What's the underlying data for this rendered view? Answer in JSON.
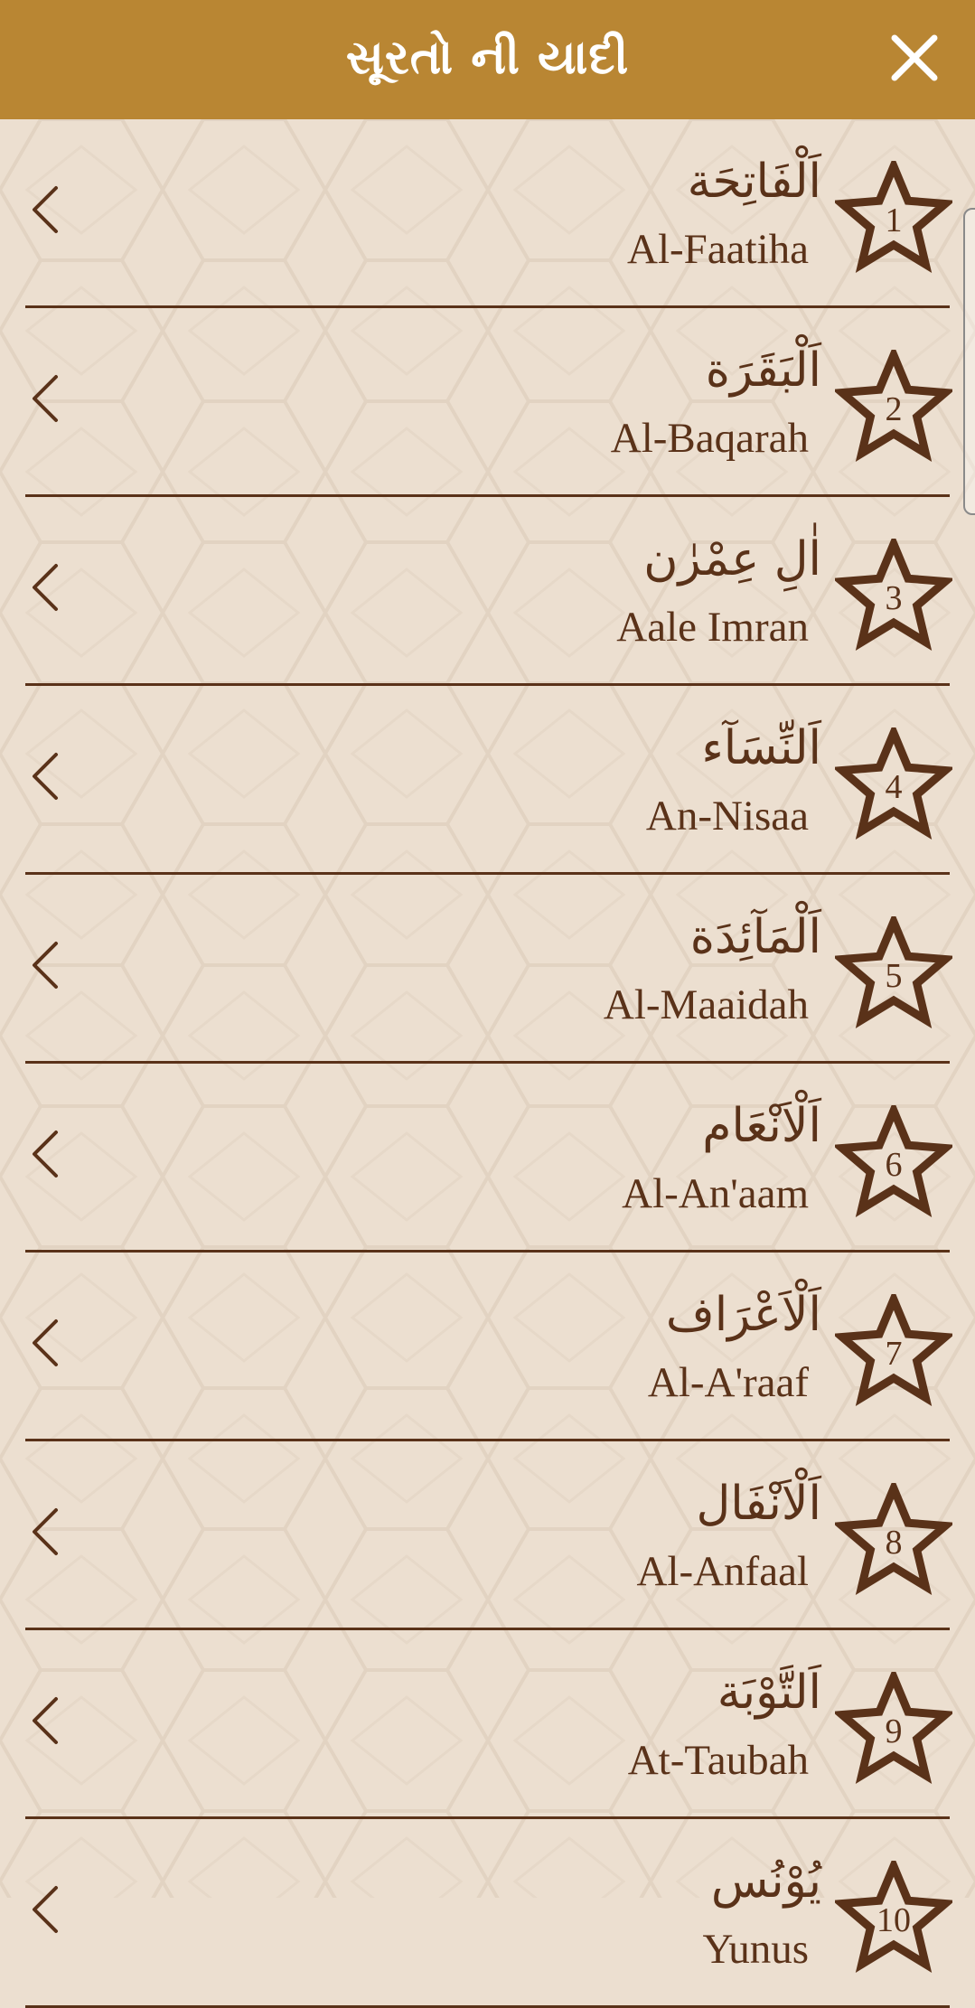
{
  "header": {
    "title": "સૂરતો ની યાદી",
    "close_icon": "close-icon"
  },
  "colors": {
    "header_bg": "#b98633",
    "page_bg": "#ecdfd0",
    "text": "#5a3219"
  },
  "surahs": [
    {
      "number": "1",
      "arabic": "اَلْفَاتِحَة",
      "name": "Al-Faatiha"
    },
    {
      "number": "2",
      "arabic": "اَلْبَقَرَة",
      "name": "Al-Baqarah"
    },
    {
      "number": "3",
      "arabic": "اٰلِ عِمْرٰن",
      "name": "Aale Imran"
    },
    {
      "number": "4",
      "arabic": "اَلنِّسَآء",
      "name": "An-Nisaa"
    },
    {
      "number": "5",
      "arabic": "اَلْمَآئِدَة",
      "name": "Al-Maaidah"
    },
    {
      "number": "6",
      "arabic": "اَلْاَنْعَام",
      "name": "Al-An'aam"
    },
    {
      "number": "7",
      "arabic": "اَلْاَعْرَاف",
      "name": "Al-A'raaf"
    },
    {
      "number": "8",
      "arabic": "اَلْاَنْفَال",
      "name": "Al-Anfaal"
    },
    {
      "number": "9",
      "arabic": "اَلتَّوْبَة",
      "name": "At-Taubah"
    },
    {
      "number": "10",
      "arabic": "يُوْنُس",
      "name": "Yunus"
    }
  ]
}
